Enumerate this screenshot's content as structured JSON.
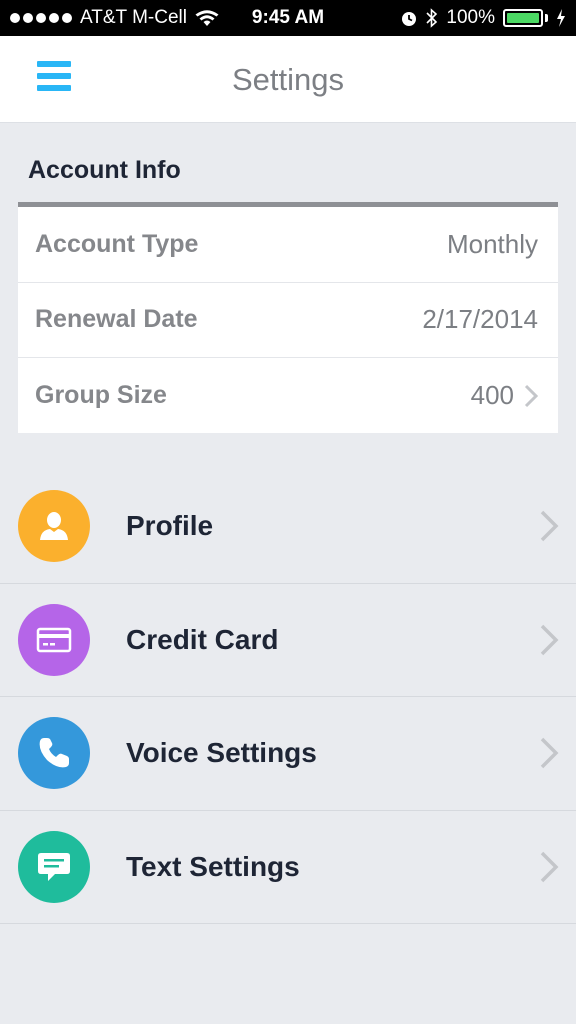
{
  "status_bar": {
    "carrier": "AT&T M-Cell",
    "time": "9:45 AM",
    "battery": "100%",
    "battery_color": "#4cd964"
  },
  "nav": {
    "title": "Settings",
    "menu_icon": "hamburger-menu-icon",
    "accent_color": "#29b6f6"
  },
  "account": {
    "title": "Account Info",
    "rows": [
      {
        "label": "Account Type",
        "value": "Monthly"
      },
      {
        "label": "Renewal Date",
        "value": "2/17/2014"
      },
      {
        "label": "Group Size",
        "value": "400"
      }
    ]
  },
  "menu": [
    {
      "label": "Profile",
      "icon": "user-icon",
      "color": "#fbb02d"
    },
    {
      "label": "Credit Card",
      "icon": "credit-card-icon",
      "color": "#b565e8"
    },
    {
      "label": "Voice Settings",
      "icon": "phone-icon",
      "color": "#3498db"
    },
    {
      "label": "Text Settings",
      "icon": "chat-bubble-icon",
      "color": "#1fbc9c"
    }
  ]
}
